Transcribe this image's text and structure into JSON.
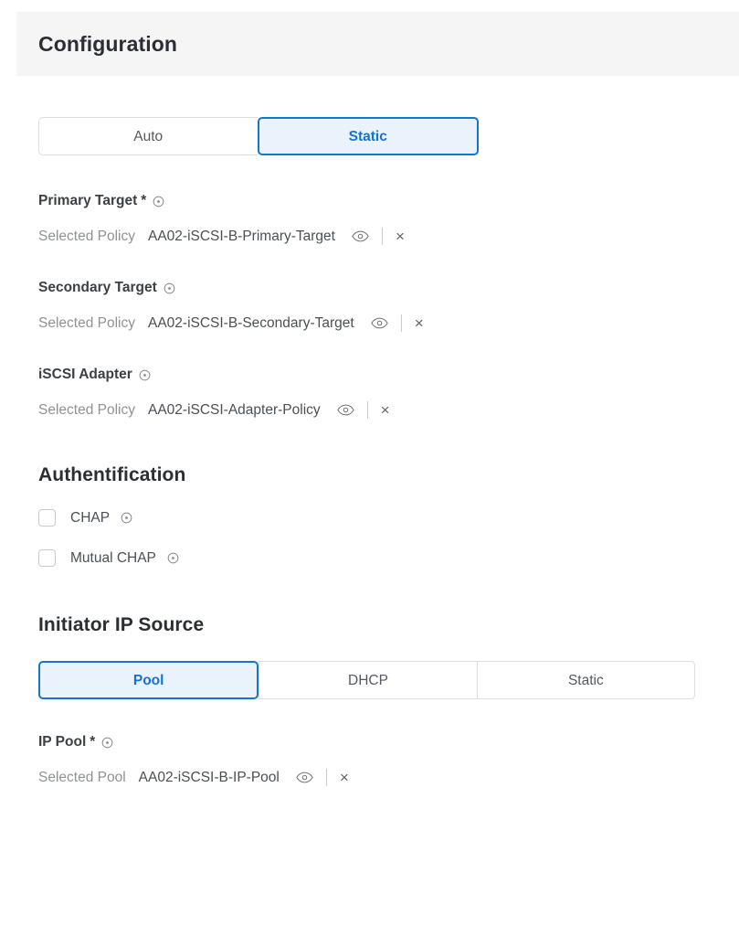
{
  "header": {
    "title": "Configuration"
  },
  "configuration_mode": {
    "options": [
      {
        "label": "Auto",
        "selected": false
      },
      {
        "label": "Static",
        "selected": true
      }
    ]
  },
  "fields": {
    "primary_target": {
      "label": "Primary Target",
      "required_marker": "*",
      "info_icon": "info-circle-icon",
      "selected_label": "Selected Policy",
      "selected_value": "AA02-iSCSI-B-Primary-Target",
      "view_icon": "eye-icon",
      "clear_icon": "×"
    },
    "secondary_target": {
      "label": "Secondary Target",
      "required_marker": "",
      "info_icon": "info-circle-icon",
      "selected_label": "Selected Policy",
      "selected_value": "AA02-iSCSI-B-Secondary-Target",
      "view_icon": "eye-icon",
      "clear_icon": "×"
    },
    "iscsi_adapter": {
      "label": "iSCSI Adapter",
      "required_marker": "",
      "info_icon": "info-circle-icon",
      "selected_label": "Selected Policy",
      "selected_value": "AA02-iSCSI-Adapter-Policy",
      "view_icon": "eye-icon",
      "clear_icon": "×"
    },
    "ip_pool": {
      "label": "IP Pool",
      "required_marker": "*",
      "info_icon": "info-circle-icon",
      "selected_label": "Selected Pool",
      "selected_value": "AA02-iSCSI-B-IP-Pool",
      "view_icon": "eye-icon",
      "clear_icon": "×"
    }
  },
  "authentification": {
    "heading": "Authentification",
    "checkboxes": [
      {
        "label": "CHAP",
        "checked": false,
        "info_icon": "info-circle-icon"
      },
      {
        "label": "Mutual CHAP",
        "checked": false,
        "info_icon": "info-circle-icon"
      }
    ]
  },
  "initiator_ip_source": {
    "heading": "Initiator IP Source",
    "options": [
      {
        "label": "Pool",
        "selected": true
      },
      {
        "label": "DHCP",
        "selected": false
      },
      {
        "label": "Static",
        "selected": false
      }
    ]
  },
  "colors": {
    "accent_blue": "#1574cd",
    "accent_blue_fill": "#eaf2fc",
    "header_bg": "#f5f5f6",
    "label_gray": "#8e9297",
    "value_gray": "#4a5056",
    "border_gray": "#dcdee0"
  }
}
